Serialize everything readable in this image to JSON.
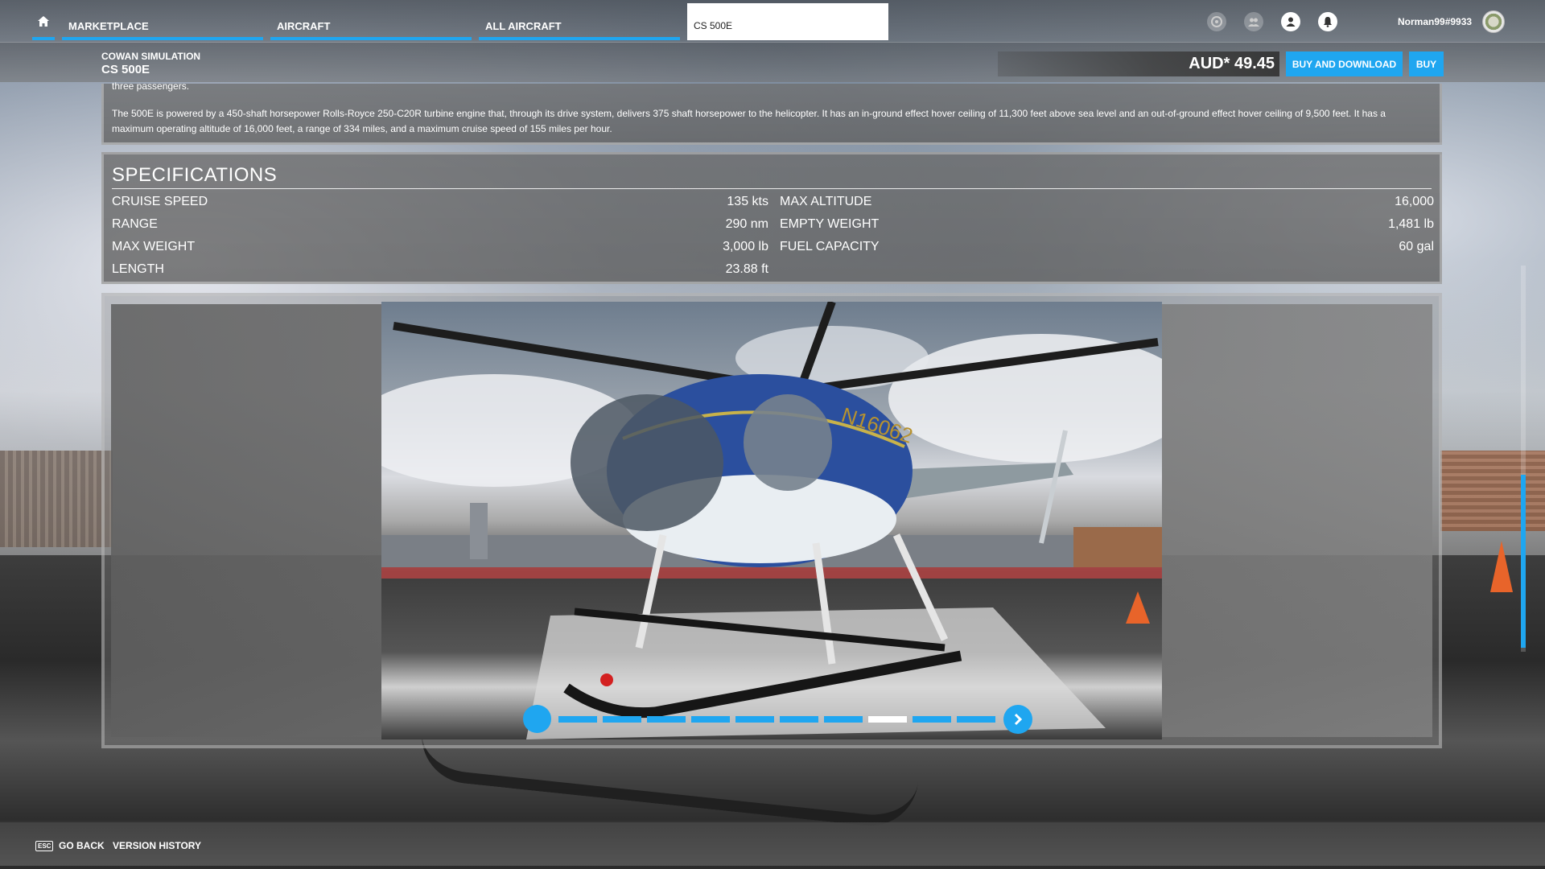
{
  "nav": {
    "home_icon": "home-icon",
    "tabs": [
      {
        "label": "MARKETPLACE"
      },
      {
        "label": "AIRCRAFT"
      },
      {
        "label": "ALL AIRCRAFT"
      },
      {
        "label": "CS 500E"
      }
    ],
    "username": "Norman99#9933"
  },
  "product": {
    "publisher": "COWAN SIMULATION",
    "name": "CS 500E",
    "price": "AUD* 49.45",
    "buy_download_label": "BUY AND DOWNLOAD",
    "buy_label": "BUY"
  },
  "description": {
    "prev_text": "three passengers.",
    "text": "The 500E is powered by a 450-shaft horsepower Rolls-Royce 250-C20R turbine engine that, through its drive system, delivers 375 shaft horsepower to the helicopter. It has an in-ground effect hover ceiling of 11,300 feet above sea level and an out-of-ground effect hover ceiling of 9,500 feet. It has a maximum operating altitude of 16,000 feet, a range of 334 miles, and a maximum cruise speed of 155 miles per hour."
  },
  "specs": {
    "title": "SPECIFICATIONS",
    "left": [
      {
        "label": "CRUISE SPEED",
        "value": "135 kts"
      },
      {
        "label": "RANGE",
        "value": "290 nm"
      },
      {
        "label": "MAX WEIGHT",
        "value": "3,000 lb"
      },
      {
        "label": "LENGTH",
        "value": "23.88 ft"
      }
    ],
    "right": [
      {
        "label": "MAX ALTITUDE",
        "value": "16,000"
      },
      {
        "label": "EMPTY WEIGHT",
        "value": "1,481 lb"
      },
      {
        "label": "FUEL CAPACITY",
        "value": "60 gal"
      }
    ]
  },
  "gallery": {
    "registration": "N16062",
    "segments": 10,
    "current_segment": 8
  },
  "footer": {
    "esc_key": "ESC",
    "go_back": "GO BACK",
    "version_history": "VERSION HISTORY"
  },
  "colors": {
    "accent": "#1fa6f0"
  }
}
